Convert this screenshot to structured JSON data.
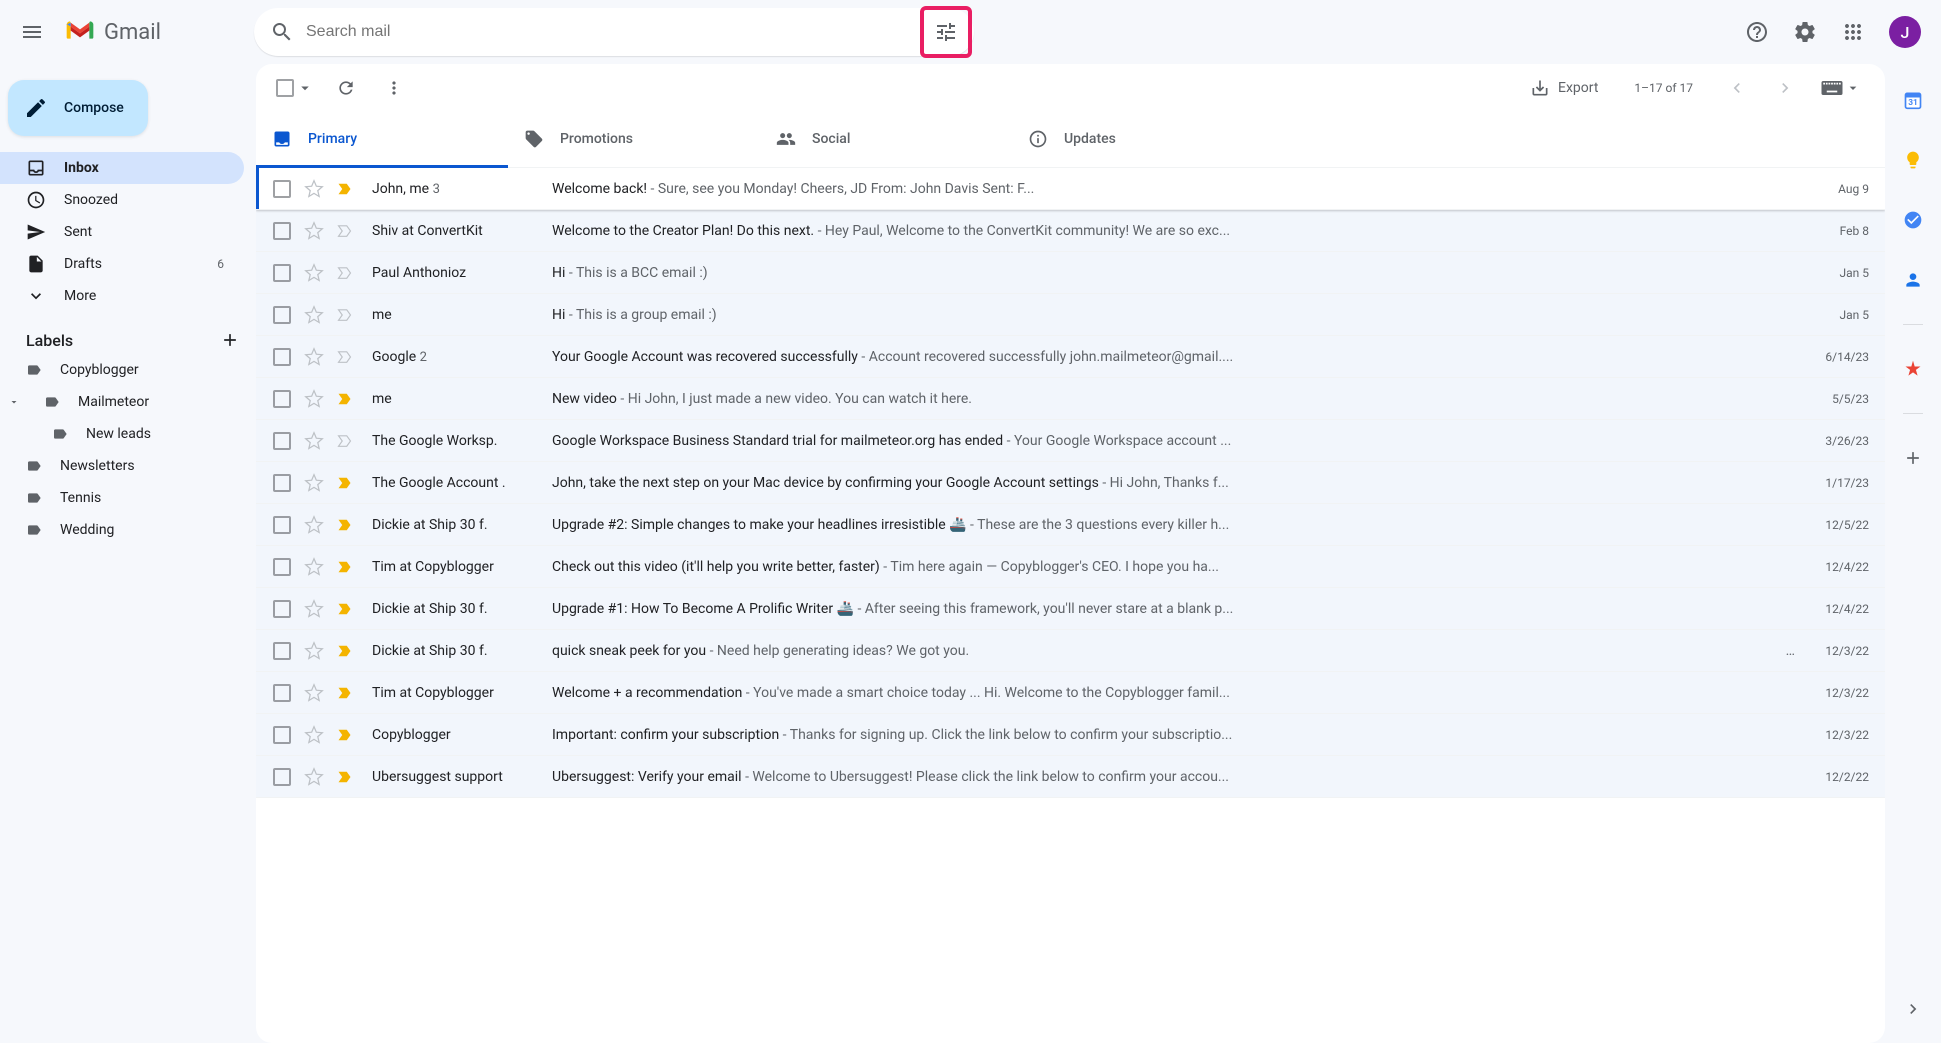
{
  "header": {
    "app_name": "Gmail",
    "search_placeholder": "Search mail",
    "avatar_initial": "J"
  },
  "sidebar": {
    "compose_label": "Compose",
    "nav": [
      {
        "icon": "inbox",
        "label": "Inbox",
        "count": "",
        "active": true
      },
      {
        "icon": "snoozed",
        "label": "Snoozed",
        "count": ""
      },
      {
        "icon": "sent",
        "label": "Sent",
        "count": ""
      },
      {
        "icon": "drafts",
        "label": "Drafts",
        "count": "6"
      },
      {
        "icon": "more",
        "label": "More",
        "count": ""
      }
    ],
    "labels_header": "Labels",
    "labels": [
      {
        "name": "Copyblogger",
        "caret": false,
        "nested": false
      },
      {
        "name": "Mailmeteor",
        "caret": true,
        "nested": false
      },
      {
        "name": "New leads",
        "caret": false,
        "nested": true
      },
      {
        "name": "Newsletters",
        "caret": false,
        "nested": false
      },
      {
        "name": "Tennis",
        "caret": false,
        "nested": false
      },
      {
        "name": "Wedding",
        "caret": false,
        "nested": false
      }
    ]
  },
  "toolbar": {
    "export_label": "Export",
    "page_info": "1–17 of 17"
  },
  "tabs": [
    {
      "id": "primary",
      "label": "Primary",
      "active": true
    },
    {
      "id": "promotions",
      "label": "Promotions",
      "active": false
    },
    {
      "id": "social",
      "label": "Social",
      "active": false
    },
    {
      "id": "updates",
      "label": "Updates",
      "active": false
    }
  ],
  "emails": [
    {
      "sender": "John, me",
      "sender_count": "3",
      "subject": "Welcome back!",
      "snippet": " - Sure, see you Monday! Cheers, JD From: John Davis <john.mailmeteor@gmail.com> Sent: F...",
      "date": "Aug 9",
      "important": true,
      "unread": false,
      "selected": true
    },
    {
      "sender": "Shiv at ConvertKit",
      "sender_count": "",
      "subject": "Welcome to the Creator Plan! Do this next.",
      "snippet": " - Hey Paul, Welcome to the ConvertKit community! We are so exc...",
      "date": "Feb 8",
      "important": false,
      "unread": false
    },
    {
      "sender": "Paul Anthonioz",
      "sender_count": "",
      "subject": "Hi",
      "snippet": " - This is a BCC email :)",
      "date": "Jan 5",
      "important": false,
      "unread": false
    },
    {
      "sender": "me",
      "sender_count": "",
      "subject": "Hi",
      "snippet": " - This is a group email :)",
      "date": "Jan 5",
      "important": false,
      "unread": false
    },
    {
      "sender": "Google",
      "sender_count": "2",
      "subject": "Your Google Account was recovered successfully",
      "snippet": " - Account recovered successfully john.mailmeteor@gmail....",
      "date": "6/14/23",
      "important": false,
      "unread": false
    },
    {
      "sender": "me",
      "sender_count": "",
      "subject": "New video",
      "snippet": " - Hi John, I just made a new video. You can watch it here.",
      "date": "5/5/23",
      "important": true,
      "unread": false
    },
    {
      "sender": "The Google Worksp.",
      "sender_count": "",
      "subject": "Google Workspace Business Standard trial for mailmeteor.org has ended",
      "snippet": " - Your Google Workspace account ...",
      "date": "3/26/23",
      "important": false,
      "unread": false
    },
    {
      "sender": "The Google Account .",
      "sender_count": "",
      "subject": "John, take the next step on your Mac device by confirming your Google Account settings",
      "snippet": " - Hi John, Thanks f...",
      "date": "1/17/23",
      "important": true,
      "unread": false
    },
    {
      "sender": "Dickie at Ship 30 f.",
      "sender_count": "",
      "subject": "Upgrade #2: Simple changes to make your headlines irresistible 🚢",
      "snippet": " - These are the 3 questions every killer h...",
      "date": "12/5/22",
      "important": true,
      "unread": false
    },
    {
      "sender": "Tim at Copyblogger",
      "sender_count": "",
      "subject": "Check out this video (it'll help you write better, faster)",
      "snippet": " - Tim here again — Copyblogger's CEO. I hope you ha...",
      "date": "12/4/22",
      "important": true,
      "unread": false
    },
    {
      "sender": "Dickie at Ship 30 f.",
      "sender_count": "",
      "subject": "Upgrade #1: How To Become A Prolific Writer 🚢",
      "snippet": " - After seeing this framework, you'll never stare at a blank p...",
      "date": "12/4/22",
      "important": true,
      "unread": false
    },
    {
      "sender": "Dickie at Ship 30 f.",
      "sender_count": "",
      "subject": "quick sneak peek for you",
      "snippet": " - Need help generating ideas? We got you.",
      "date": "12/3/22",
      "important": true,
      "unread": false,
      "ellipsis": true
    },
    {
      "sender": "Tim at Copyblogger",
      "sender_count": "",
      "subject": "Welcome + a recommendation",
      "snippet": " - You've made a smart choice today ... Hi. Welcome to the Copyblogger famil...",
      "date": "12/3/22",
      "important": true,
      "unread": false
    },
    {
      "sender": "Copyblogger",
      "sender_count": "",
      "subject": "Important: confirm your subscription",
      "snippet": " - Thanks for signing up. Click the link below to confirm your subscriptio...",
      "date": "12/3/22",
      "important": true,
      "unread": false
    },
    {
      "sender": "Ubersuggest support",
      "sender_count": "",
      "subject": "Ubersuggest: Verify your email",
      "snippet": " - Welcome to Ubersuggest! Please click the link below to confirm your accou...",
      "date": "12/2/22",
      "important": true,
      "unread": false
    }
  ]
}
